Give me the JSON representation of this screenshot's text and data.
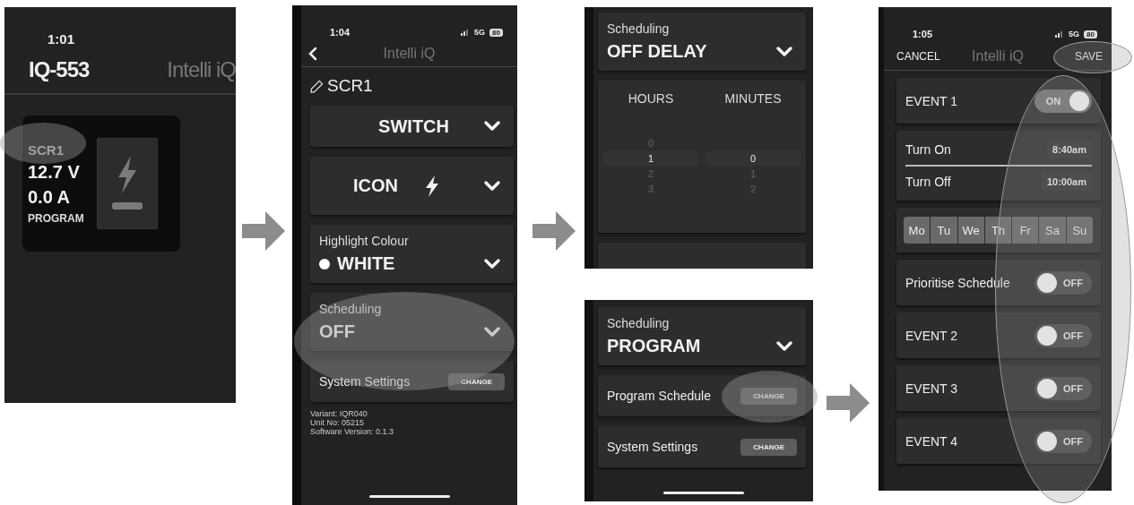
{
  "screen_home": {
    "time": "1:01",
    "device_name": "IQ-553",
    "brand": "Intelli iQ",
    "tile": {
      "name": "SCR1",
      "voltage": "12.7 V",
      "current": "0.0 A",
      "mode": "PROGRAM"
    }
  },
  "screen_settings": {
    "status": {
      "time": "1:04",
      "network": "5G",
      "battery": "80"
    },
    "title": "Intelli iQ",
    "switch_name": "SCR1",
    "dropdowns": [
      {
        "kind": "value",
        "value": "SWITCH"
      },
      {
        "kind": "icon",
        "value": "ICON"
      },
      {
        "kind": "labeled",
        "label": "Highlight Colour",
        "value": "WHITE",
        "color": "#ffffff"
      },
      {
        "kind": "labeled",
        "label": "Scheduling",
        "value": "OFF"
      }
    ],
    "rows": [
      {
        "label": "System Settings",
        "button": "CHANGE"
      }
    ],
    "info": [
      "Variant: IQR040",
      "Unit No: 05215",
      "Software Version: 0.1.3"
    ]
  },
  "screen_off_delay": {
    "scheduling": {
      "label": "Scheduling",
      "value": "OFF DELAY"
    },
    "picker": [
      {
        "heading": "HOURS",
        "options": [
          {
            "value": "0",
            "selected": false
          },
          {
            "value": "1",
            "selected": true
          },
          {
            "value": "2",
            "selected": false
          },
          {
            "value": "3",
            "selected": false
          }
        ]
      },
      {
        "heading": "MINUTES",
        "options": [
          {
            "value": "0",
            "selected": true
          },
          {
            "value": "1",
            "selected": false
          },
          {
            "value": "2",
            "selected": false
          }
        ]
      }
    ]
  },
  "screen_program": {
    "scheduling": {
      "label": "Scheduling",
      "value": "PROGRAM"
    },
    "rows": [
      {
        "label": "Program Schedule",
        "button": "CHANGE"
      },
      {
        "label": "System Settings",
        "button": "CHANGE"
      }
    ]
  },
  "screen_events": {
    "status": {
      "time": "1:05",
      "network": "5G",
      "battery": "80"
    },
    "cancel": "CANCEL",
    "title": "Intelli iQ",
    "save": "SAVE",
    "items": [
      {
        "kind": "toggle",
        "label": "EVENT 1",
        "on": true,
        "state_text": "ON"
      },
      {
        "kind": "times",
        "times": [
          {
            "label": "Turn On",
            "value": "8:40am"
          },
          {
            "label": "Turn Off",
            "value": "10:00am"
          }
        ]
      },
      {
        "kind": "days",
        "days": [
          {
            "label": "Mo",
            "selected": true
          },
          {
            "label": "Tu",
            "selected": true
          },
          {
            "label": "We",
            "selected": true
          },
          {
            "label": "Th",
            "selected": true
          },
          {
            "label": "Fr",
            "selected": true
          },
          {
            "label": "Sa",
            "selected": true
          },
          {
            "label": "Su",
            "selected": true
          }
        ]
      },
      {
        "kind": "toggle",
        "label": "Prioritise Schedule",
        "on": false,
        "state_text": "OFF"
      },
      {
        "kind": "toggle",
        "label": "EVENT 2",
        "on": false,
        "state_text": "OFF"
      },
      {
        "kind": "toggle",
        "label": "EVENT 3",
        "on": false,
        "state_text": "OFF"
      },
      {
        "kind": "toggle",
        "label": "EVENT 4",
        "on": false,
        "state_text": "OFF"
      }
    ]
  }
}
